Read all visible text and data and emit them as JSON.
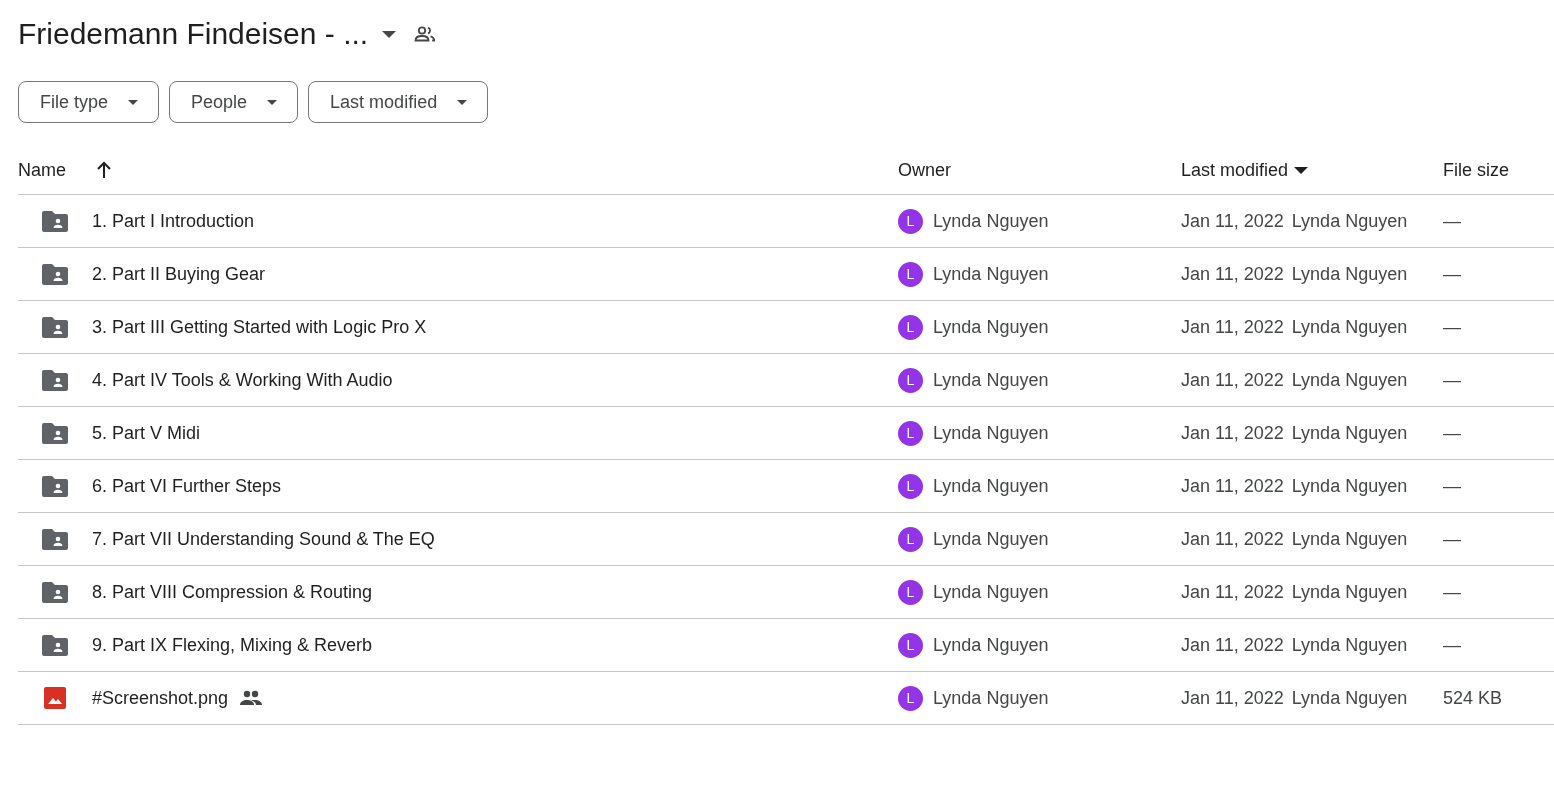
{
  "header": {
    "title": "Friedemann Findeisen - ...",
    "shared": true
  },
  "filters": [
    {
      "label": "File type"
    },
    {
      "label": "People"
    },
    {
      "label": "Last modified"
    }
  ],
  "table": {
    "columns": [
      {
        "label": "Name",
        "kind": "toggle"
      },
      {
        "label": "Owner",
        "kind": "plain"
      },
      {
        "label": "Last modified",
        "kind": "sorted"
      },
      {
        "label": "File size",
        "kind": "plain"
      }
    ],
    "rows": [
      {
        "kind": "folder",
        "name": "1. Part I Introduction",
        "shared": false,
        "owner_initial": "L",
        "owner": "Lynda Nguyen",
        "modified": "Jan 11, 2022",
        "modified_by": "Lynda Nguyen",
        "size": "—"
      },
      {
        "kind": "folder",
        "name": "2. Part II Buying Gear",
        "shared": false,
        "owner_initial": "L",
        "owner": "Lynda Nguyen",
        "modified": "Jan 11, 2022",
        "modified_by": "Lynda Nguyen",
        "size": "—"
      },
      {
        "kind": "folder",
        "name": "3. Part III Getting Started with Logic Pro X",
        "shared": false,
        "owner_initial": "L",
        "owner": "Lynda Nguyen",
        "modified": "Jan 11, 2022",
        "modified_by": "Lynda Nguyen",
        "size": "—"
      },
      {
        "kind": "folder",
        "name": "4. Part IV Tools & Working With Audio",
        "shared": false,
        "owner_initial": "L",
        "owner": "Lynda Nguyen",
        "modified": "Jan 11, 2022",
        "modified_by": "Lynda Nguyen",
        "size": "—"
      },
      {
        "kind": "folder",
        "name": "5. Part V Midi",
        "shared": false,
        "owner_initial": "L",
        "owner": "Lynda Nguyen",
        "modified": "Jan 11, 2022",
        "modified_by": "Lynda Nguyen",
        "size": "—"
      },
      {
        "kind": "folder",
        "name": "6. Part VI Further Steps",
        "shared": false,
        "owner_initial": "L",
        "owner": "Lynda Nguyen",
        "modified": "Jan 11, 2022",
        "modified_by": "Lynda Nguyen",
        "size": "—"
      },
      {
        "kind": "folder",
        "name": "7. Part VII Understanding Sound & The EQ",
        "shared": false,
        "owner_initial": "L",
        "owner": "Lynda Nguyen",
        "modified": "Jan 11, 2022",
        "modified_by": "Lynda Nguyen",
        "size": "—"
      },
      {
        "kind": "folder",
        "name": "8. Part VIII Compression & Routing",
        "shared": false,
        "owner_initial": "L",
        "owner": "Lynda Nguyen",
        "modified": "Jan 11, 2022",
        "modified_by": "Lynda Nguyen",
        "size": "—"
      },
      {
        "kind": "folder",
        "name": "9. Part IX Flexing, Mixing & Reverb",
        "shared": false,
        "owner_initial": "L",
        "owner": "Lynda Nguyen",
        "modified": "Jan 11, 2022",
        "modified_by": "Lynda Nguyen",
        "size": "—"
      },
      {
        "kind": "image",
        "name": "#Screenshot.png",
        "shared": true,
        "owner_initial": "L",
        "owner": "Lynda Nguyen",
        "modified": "Jan 11, 2022",
        "modified_by": "Lynda Nguyen",
        "size": "524 KB"
      }
    ]
  }
}
